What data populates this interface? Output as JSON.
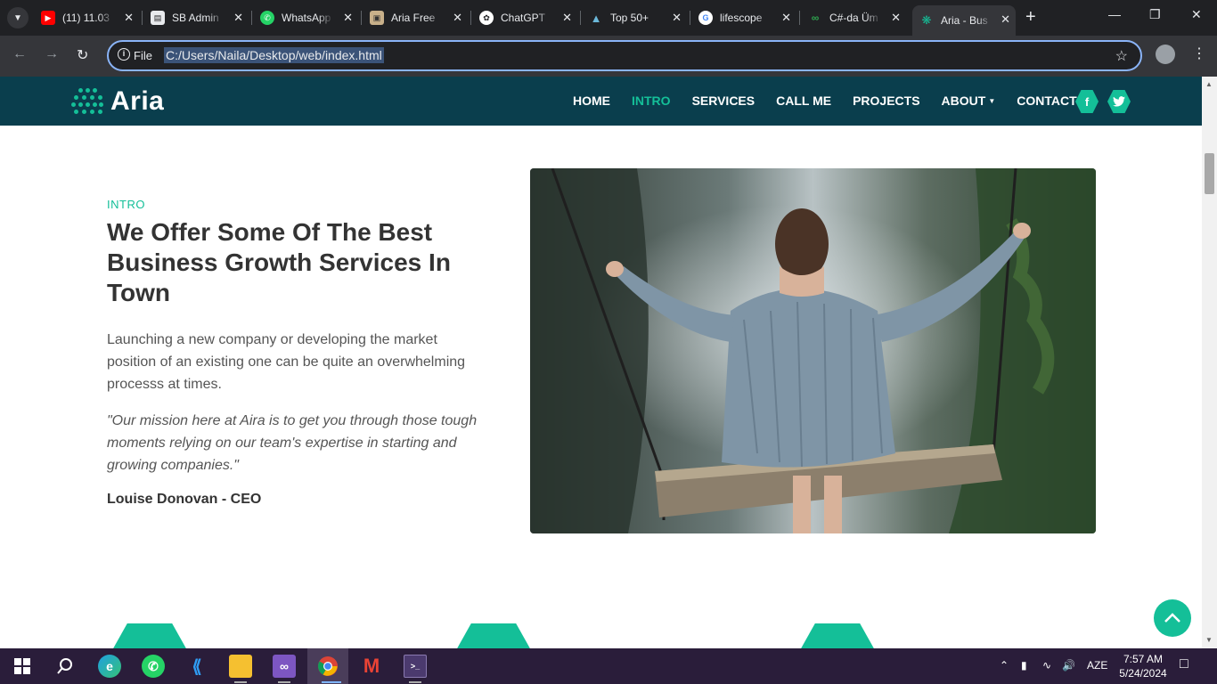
{
  "browser": {
    "tabs": [
      {
        "title": "(11) 11.03",
        "icon": "youtube-icon",
        "color": "#ff0000"
      },
      {
        "title": "SB Admin",
        "icon": "document-icon",
        "color": "#e8eaed"
      },
      {
        "title": "WhatsApp",
        "icon": "whatsapp-icon",
        "color": "#25d366"
      },
      {
        "title": "Aria Free",
        "icon": "image-icon",
        "color": "#c8b08a"
      },
      {
        "title": "ChatGPT",
        "icon": "chatgpt-icon",
        "color": "#ffffff"
      },
      {
        "title": "Top 50+",
        "icon": "mountain-icon",
        "color": "#6bb8d9"
      },
      {
        "title": "lifescope",
        "icon": "google-icon",
        "color": "#ffffff"
      },
      {
        "title": "C#-da Üm",
        "icon": "code-icon",
        "color": "#2da44e"
      },
      {
        "title": "Aria - Bus",
        "icon": "aria-icon",
        "color": "#14bf98"
      }
    ],
    "active_tab": 8,
    "address_scheme": "File",
    "address_url": "C:/Users/Naila/Desktop/web/index.html"
  },
  "site": {
    "brand": "Aria",
    "nav": [
      "HOME",
      "INTRO",
      "SERVICES",
      "CALL ME",
      "PROJECTS",
      "ABOUT",
      "CONTACT"
    ],
    "nav_active": "INTRO",
    "social": {
      "facebook": "f",
      "twitter": "t"
    },
    "accent": "#14bf98",
    "nav_bg": "#0a3e4d"
  },
  "intro": {
    "label": "INTRO",
    "title": "We Offer Some Of The Best Business Growth Services In Town",
    "paragraph": "Launching a new company or developing the market position of an existing one can be quite an overwhelming processs at times.",
    "quote": "\"Our mission here at Aira is to get you through those tough moments relying on our team's expertise in starting and growing companies.\"",
    "author": "Louise Donovan - CEO"
  },
  "taskbar": {
    "language": "AZE",
    "time": "7:57 AM",
    "date": "5/24/2024"
  }
}
